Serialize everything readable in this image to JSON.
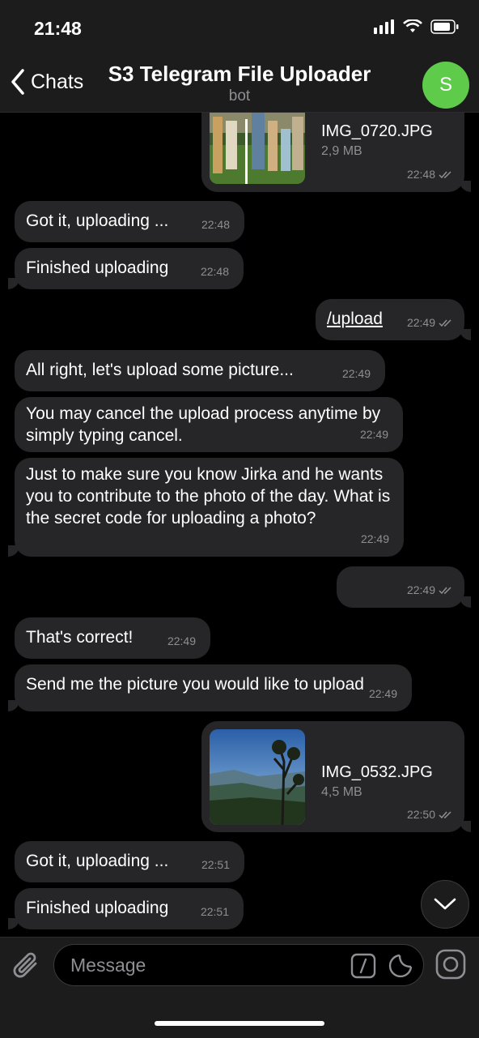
{
  "status": {
    "time": "21:48"
  },
  "header": {
    "back_label": "Chats",
    "title": "S3 Telegram File Uploader",
    "subtitle": "bot",
    "avatar_letter": "S"
  },
  "messages": [
    {
      "type": "file",
      "dir": "out",
      "file_name": "IMG_0720.JPG",
      "file_size": "2,9 MB",
      "time": "22:48"
    },
    {
      "type": "text",
      "dir": "in",
      "text": "Got it, uploading ...",
      "time": "22:48"
    },
    {
      "type": "text",
      "dir": "in",
      "text": "Finished uploading",
      "time": "22:48"
    },
    {
      "type": "text",
      "dir": "out",
      "text": "/upload",
      "time": "22:49"
    },
    {
      "type": "text",
      "dir": "in",
      "text": "All right, let's upload some picture...",
      "time": "22:49"
    },
    {
      "type": "text",
      "dir": "in",
      "text": "You may cancel the upload process anytime by simply typing cancel.",
      "time": "22:49"
    },
    {
      "type": "text",
      "dir": "in",
      "text": "Just to make sure you know Jirka and he wants you to contribute  to the photo of the day. What is the secret code for uploading a photo?",
      "time": "22:49"
    },
    {
      "type": "text",
      "dir": "out",
      "text": "",
      "time": "22:49"
    },
    {
      "type": "text",
      "dir": "in",
      "text": "That's correct!",
      "time": "22:49"
    },
    {
      "type": "text",
      "dir": "in",
      "text": "Send me the picture you would like to upload",
      "time": "22:49"
    },
    {
      "type": "file",
      "dir": "out",
      "file_name": "IMG_0532.JPG",
      "file_size": "4,5 MB",
      "time": "22:50"
    },
    {
      "type": "text",
      "dir": "in",
      "text": "Got it, uploading ...",
      "time": "22:51"
    },
    {
      "type": "text",
      "dir": "in",
      "text": "Finished uploading",
      "time": "22:51"
    }
  ],
  "input": {
    "placeholder": "Message"
  },
  "colors": {
    "accent": "#5ecb4a",
    "bubble": "#262628",
    "bar": "#1c1c1d"
  }
}
